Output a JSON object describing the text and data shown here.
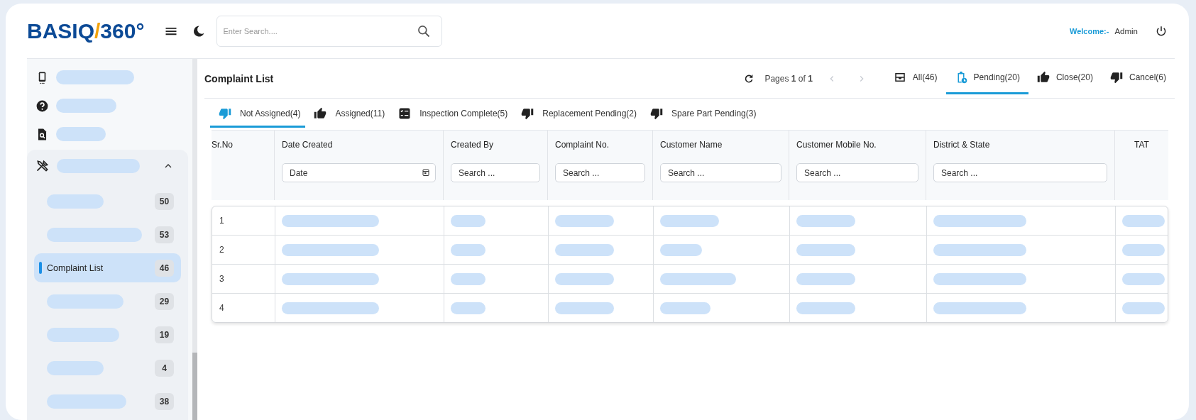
{
  "logo": [
    {
      "text": "BASIQ",
      "accent": false
    },
    {
      "text": "/",
      "accent": true
    },
    {
      "text": "360°",
      "accent": false
    }
  ],
  "header": {
    "search": {
      "placeholder": "Enter Search...."
    },
    "welcome": "Welcome:-",
    "user": "Admin"
  },
  "sidebar": {
    "items": [
      {
        "kind": "skeleton"
      },
      {
        "kind": "skeleton"
      },
      {
        "kind": "skeleton"
      }
    ],
    "group": {
      "kind": "skeleton",
      "expanded": true,
      "children": [
        {
          "kind": "skeleton",
          "count": "50",
          "selected": false
        },
        {
          "kind": "skeleton",
          "count": "53",
          "selected": false
        },
        {
          "kind": "label",
          "label": "Complaint List",
          "count": "46",
          "selected": true
        },
        {
          "kind": "skeleton",
          "count": "29",
          "selected": false
        },
        {
          "kind": "skeleton",
          "count": "19",
          "selected": false
        },
        {
          "kind": "skeleton",
          "count": "4",
          "selected": false
        },
        {
          "kind": "skeleton",
          "count": "38",
          "selected": false
        }
      ]
    }
  },
  "panel": {
    "title": "Complaint List",
    "pager": {
      "text": "Pages **1** of **1**",
      "prev_disabled": true,
      "next_disabled": true
    },
    "status_tabs": [
      {
        "label": "All(46)",
        "selected": false
      },
      {
        "label": "Pending(20)",
        "selected": true
      },
      {
        "label": "Close(20)",
        "selected": false
      },
      {
        "label": "Cancel(6)",
        "selected": false
      }
    ],
    "sub_tabs": [
      {
        "label": "Not Assigned(4)",
        "selected": true
      },
      {
        "label": "Assigned(11)",
        "selected": false
      },
      {
        "label": "Inspection Complete(5)",
        "selected": false
      },
      {
        "label": "Replacement Pending(2)",
        "selected": false
      },
      {
        "label": "Spare Part Pending(3)",
        "selected": false
      }
    ]
  },
  "table": {
    "loading": true,
    "columns": [
      {
        "label": "Sr.No"
      },
      {
        "label": "Date Created",
        "filter": {
          "kind": "date",
          "placeholder": "Date"
        }
      },
      {
        "label": "Created By",
        "filter": {
          "kind": "text",
          "placeholder": "Search ..."
        }
      },
      {
        "label": "Complaint No.",
        "filter": {
          "kind": "text",
          "placeholder": "Search ..."
        }
      },
      {
        "label": "Customer Name",
        "filter": {
          "kind": "text",
          "placeholder": "Search ..."
        }
      },
      {
        "label": "Customer Mobile No.",
        "filter": {
          "kind": "text",
          "placeholder": "Search ..."
        }
      },
      {
        "label": "District & State",
        "filter": {
          "kind": "text",
          "placeholder": "Search ..."
        }
      },
      {
        "label": "TAT"
      }
    ],
    "rows": [
      {
        "sr_no": "1"
      },
      {
        "sr_no": "2"
      },
      {
        "sr_no": "3"
      },
      {
        "sr_no": "4"
      }
    ]
  }
}
